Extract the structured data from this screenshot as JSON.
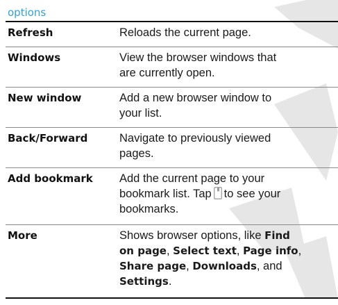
{
  "header": {
    "title": "options",
    "color": "#2fa3d6"
  },
  "rows": [
    {
      "name": "Refresh",
      "desc": [
        "Reloads the current page."
      ]
    },
    {
      "name": "Windows",
      "desc": [
        "View the browser windows that",
        "are currently open."
      ]
    },
    {
      "name": "New window",
      "desc": [
        "Add a new browser window to",
        "your list."
      ]
    },
    {
      "name": "Back/Forward",
      "desc": [
        "Navigate to previously viewed",
        "pages."
      ]
    },
    {
      "name": "Add bookmark",
      "desc": [
        "Add the current page to your",
        "bookmark list. Tap",
        "to see your",
        "bookmarks."
      ]
    },
    {
      "name": "More",
      "desc": [
        "Shows browser options, like",
        "Find",
        "on page",
        "Select text",
        "Page info",
        "Share page",
        "Downloads",
        "and",
        "Settings"
      ]
    }
  ],
  "icons": {
    "bookmark": "bookmark-icon"
  },
  "watermark": {
    "color": "#e6e6e6"
  }
}
